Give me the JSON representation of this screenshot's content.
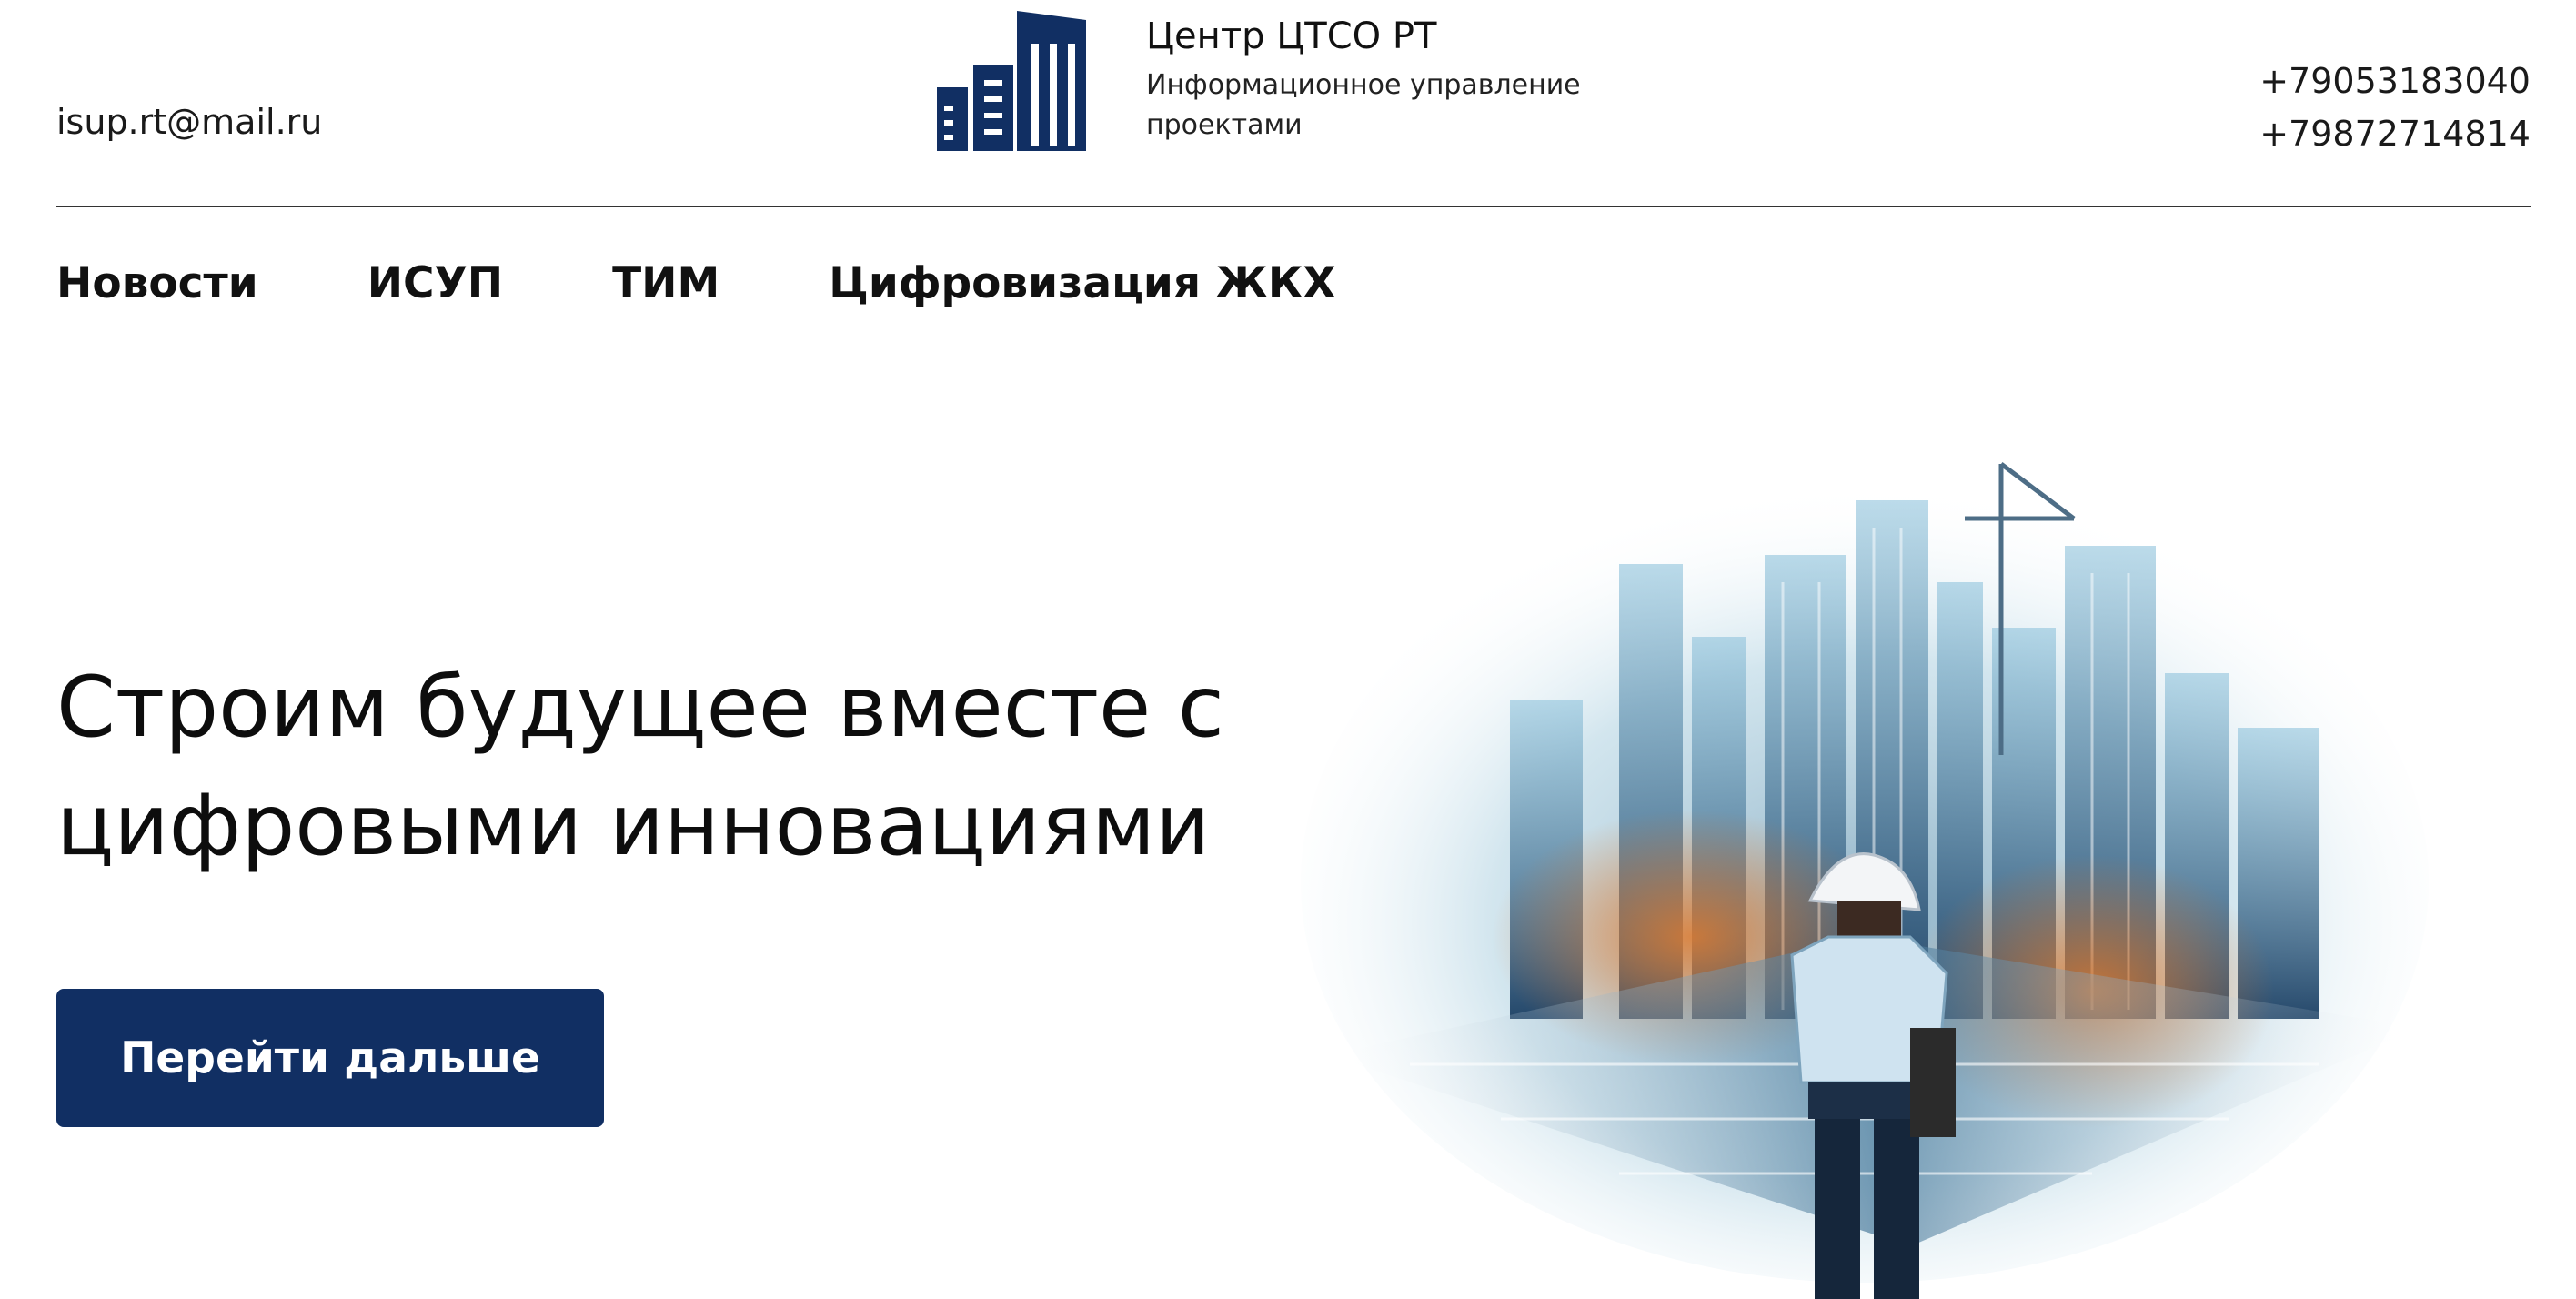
{
  "header": {
    "email": "isup.rt@mail.ru",
    "brand": {
      "logo_icon": "buildings-logo-icon",
      "title": "Центр ЦТСО РТ",
      "subtitle": "Информационное управление проектами"
    },
    "phones": [
      "+79053183040",
      "+79872714814"
    ]
  },
  "nav": {
    "items": [
      {
        "label": "Новости"
      },
      {
        "label": "ИСУП"
      },
      {
        "label": "ТИМ"
      },
      {
        "label": "Цифровизация ЖКХ"
      }
    ]
  },
  "hero": {
    "title": "Строим будущее вместе с цифровыми инновациями",
    "cta_label": "Перейти дальше",
    "image": "construction-worker-city-illustration"
  },
  "colors": {
    "brand_navy": "#112f63",
    "text": "#111111",
    "background": "#ffffff"
  }
}
